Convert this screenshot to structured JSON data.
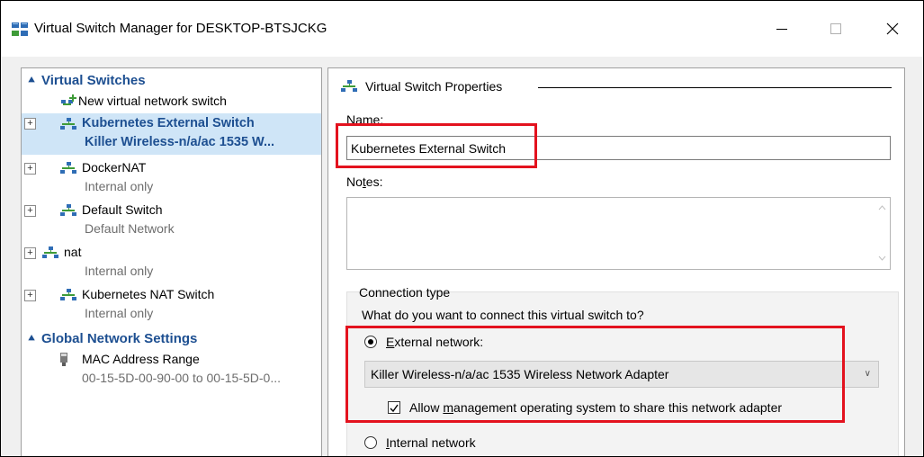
{
  "window": {
    "title": "Virtual Switch Manager for DESKTOP-BTSJCKG"
  },
  "left_panel": {
    "virtual_switches_header": "Virtual Switches",
    "new_switch_label": "New virtual network switch",
    "switches": [
      {
        "name": "Kubernetes External Switch",
        "detail": "Killer Wireless-n/a/ac 1535 W...",
        "selected": true
      },
      {
        "name": "DockerNAT",
        "detail": "Internal only",
        "selected": false
      },
      {
        "name": "Default Switch",
        "detail": "Default Network",
        "selected": false
      },
      {
        "name": "nat",
        "detail": "Internal only",
        "selected": false
      },
      {
        "name": "Kubernetes NAT Switch",
        "detail": "Internal only",
        "selected": false
      }
    ],
    "global_header": "Global Network Settings",
    "mac_label": "MAC Address Range",
    "mac_value": "00-15-5D-00-90-00 to 00-15-5D-0..."
  },
  "right_panel": {
    "group_title": "Virtual Switch Properties",
    "name_label": "Name:",
    "name_value": "Kubernetes External Switch",
    "notes_label_pre": "No",
    "notes_label_accel": "t",
    "notes_label_post": "es:",
    "notes_value": "",
    "connection_type_label": "Connection type",
    "connection_question": "What do you want to connect this virtual switch to?",
    "external_accel": "E",
    "external_rest": "xternal network:",
    "external_checked": true,
    "adapter_value": "Killer Wireless-n/a/ac 1535 Wireless Network Adapter",
    "allow_pre": "Allow ",
    "allow_accel": "m",
    "allow_post": "anagement operating system to share this network adapter",
    "allow_checked": true,
    "internal_accel": "I",
    "internal_rest": "nternal network",
    "internal_checked": false
  },
  "colors": {
    "highlight_red": "#e3121e",
    "selection_blue": "#cfe5f7",
    "section_header_blue": "#1d4f91",
    "icon_green": "#3e9b38",
    "icon_blue": "#2f6db5"
  },
  "icons": {
    "app": "virtual-switch-manager-icon",
    "network": "network-switch-icon",
    "new_switch": "new-switch-icon",
    "mac": "network-adapter-icon"
  }
}
